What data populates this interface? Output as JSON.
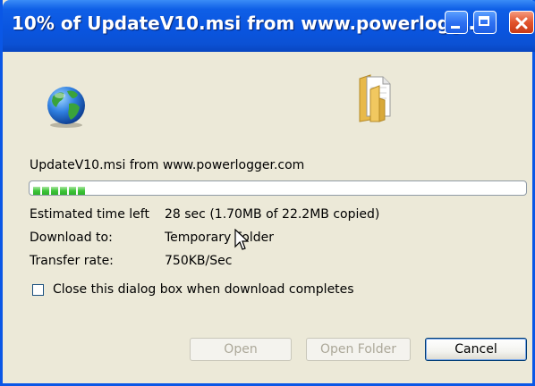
{
  "window": {
    "title": "10% of UpdateV10.msi from www.powerlogg…"
  },
  "titlebar_buttons": {
    "minimize": "minimize-icon",
    "maximize": "maximize-icon",
    "close": "close-icon"
  },
  "icons": {
    "source": "globe-icon",
    "destination": "folder-document-icon"
  },
  "download": {
    "file_line": "UpdateV10.msi from www.powerlogger.com",
    "progress_percent": 10,
    "progress_segments_visible": 6,
    "estimated_label": "Estimated time left",
    "estimated_value": "28 sec (1.70MB of 22.2MB copied)",
    "download_to_label": "Download to:",
    "download_to_value": "Temporary Folder",
    "transfer_rate_label": "Transfer rate:",
    "transfer_rate_value": "750KB/Sec"
  },
  "options": {
    "close_when_done_label": "Close this dialog box when download completes",
    "close_when_done_checked": false
  },
  "buttons": {
    "open": "Open",
    "open_folder": "Open Folder",
    "cancel": "Cancel"
  },
  "colors": {
    "titlebar": "#0a55e0",
    "dialog_bg": "#ece9d8",
    "progress_fill": "#3fc63a"
  }
}
